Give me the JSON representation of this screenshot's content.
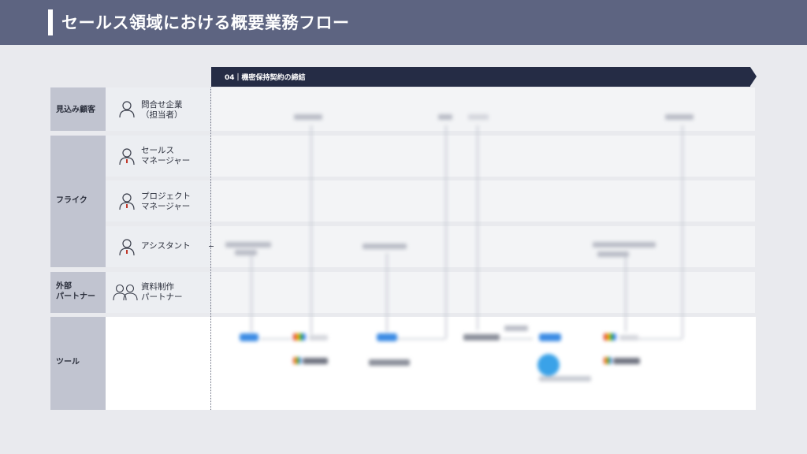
{
  "header": {
    "title": "セールス領域における概要業務フロー"
  },
  "section": {
    "label": "04｜機密保持契約の締結"
  },
  "groups": [
    {
      "id": "prospect",
      "label": "見込み顧客"
    },
    {
      "id": "company",
      "label": "フライク"
    },
    {
      "id": "partner",
      "label_line1": "外部",
      "label_line2": "パートナー"
    },
    {
      "id": "tools",
      "label": "ツール"
    }
  ],
  "roles": [
    {
      "id": "inquiry-company",
      "line1": "問合せ企業",
      "line2": "（担当者）"
    },
    {
      "id": "sales-manager",
      "line1": "セールス",
      "line2": "マネージャー"
    },
    {
      "id": "project-manager",
      "line1": "プロジェクト",
      "line2": "マネージャー"
    },
    {
      "id": "assistant",
      "line1": "アシスタント"
    },
    {
      "id": "material-partner",
      "line1": "資料制作",
      "line2": "パートナー"
    }
  ],
  "colors": {
    "header_bg": "#5d6481",
    "banner_bg": "#252c45",
    "group_bg": "#c1c4d0",
    "role_bg": "#eceef2",
    "page_bg": "#e9eaee",
    "tool_blue": "#3b8be4"
  },
  "icons": {
    "person": "person-outline-icon",
    "partner": "two-people-outline-icon"
  }
}
